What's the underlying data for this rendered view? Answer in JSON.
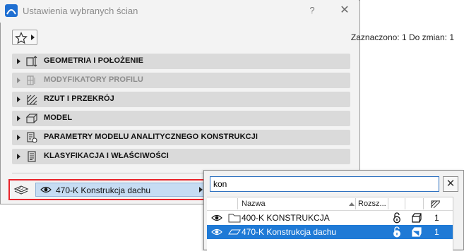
{
  "dialog": {
    "title": "Ustawienia wybranych ścian",
    "help_label": "?",
    "close_label": "✕",
    "status": "Zaznaczono: 1 Do zmian: 1",
    "panels": [
      {
        "label": "GEOMETRIA I POŁOŻENIE",
        "icon": "geometry-icon",
        "enabled": true
      },
      {
        "label": "MODYFIKATORY PROFILU",
        "icon": "profile-modifier-icon",
        "enabled": false
      },
      {
        "label": "RZUT I PRZEKRÓJ",
        "icon": "floor-plan-section-icon",
        "enabled": true
      },
      {
        "label": "MODEL",
        "icon": "model-box-icon",
        "enabled": true
      },
      {
        "label": "PARAMETRY MODELU ANALITYCZNEGO KONSTRUKCJI",
        "icon": "analytical-model-icon",
        "enabled": true
      },
      {
        "label": "KLASYFIKACJA I WŁAŚCIWOŚCI",
        "icon": "classification-icon",
        "enabled": true
      }
    ],
    "layer_select": {
      "value": "470-K Konstrukcja dachu",
      "icon": "eye-icon"
    }
  },
  "popup": {
    "search_value": "kon",
    "clear_label": "✕",
    "columns": {
      "name": "Nazwa",
      "ext": "Rozsz..."
    },
    "rows": [
      {
        "name": "400-K KONSTRUKCJA",
        "count": "1",
        "selected": false,
        "kind": "folder"
      },
      {
        "name": "470-K Konstrukcja dachu",
        "count": "1",
        "selected": true,
        "kind": "layer"
      }
    ]
  },
  "colors": {
    "accent": "#1f7ad6",
    "highlight_frame": "#e8232a",
    "select_bg": "#c6dcf3"
  }
}
